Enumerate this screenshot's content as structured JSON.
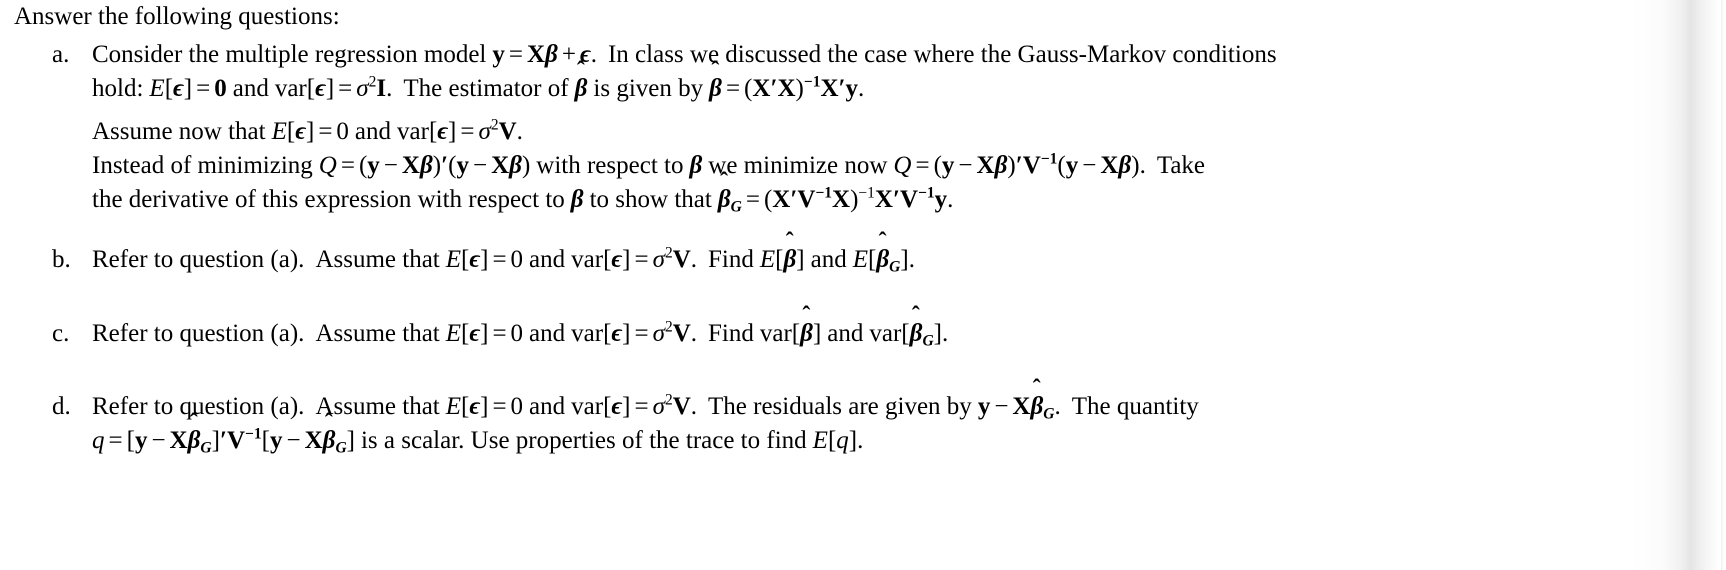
{
  "document": {
    "type": "homework-question-sheet",
    "lead_in": "Answer the following questions:",
    "text_color": "#000000",
    "background_color": "#ffffff"
  },
  "questions": [
    {
      "marker": "a.",
      "lines": [
        {
          "id": "a1",
          "plain": "Consider the multiple regression model y = Xβ + ϵ. In class we discussed the case where the Gauss-Markov conditions"
        },
        {
          "id": "a2",
          "plain": "hold: E[ϵ] = 0 and var[ϵ] = σ²I. The estimator of β̂ is given by β̂ = (X′X)⁻¹X′y."
        },
        {
          "id": "a3",
          "plain": "Assume now that E[ϵ] = 0 and var[ϵ] = σ²V."
        },
        {
          "id": "a4",
          "plain": "Instead of minimizing Q = (y − Xβ)′(y − Xβ) with respect to β we minimize now Q = (y − Xβ)′V⁻¹(y − Xβ). Take"
        },
        {
          "id": "a5",
          "plain": "the derivative of this expression with respect to β to show that β̂_G = (X′V⁻¹X)⁻¹X′V⁻¹y."
        }
      ],
      "words": {
        "consider": "Consider the multiple regression model",
        "in_class": "In class we discussed the case where the Gauss-Markov conditions",
        "hold": "hold:",
        "and": "and",
        "the_estimator": "The estimator of",
        "is_given_by": "is given by",
        "assume_now": "Assume now that",
        "instead": "Instead of minimizing",
        "with_respect": "with respect to",
        "we_minimize": "we minimize now",
        "take": "Take",
        "derivative": "the derivative of this expression with respect to",
        "to_show": "to show that"
      }
    },
    {
      "marker": "b.",
      "lines": [
        {
          "id": "b1",
          "plain": "Refer to question (a). Assume that E[ϵ] = 0 and var[ϵ] = σ²V. Find E[β̂] and E[β̂_G]."
        }
      ],
      "words": {
        "refer": "Refer to question (a).",
        "assume_that": "Assume that",
        "and": "and",
        "find": "Find"
      }
    },
    {
      "marker": "c.",
      "lines": [
        {
          "id": "c1",
          "plain": "Refer to question (a). Assume that E[ϵ] = 0 and var[ϵ] = σ²V. Find var[β̂] and var[β̂_G]."
        }
      ],
      "words": {
        "refer": "Refer to question (a).",
        "assume_that": "Assume that",
        "and": "and",
        "find": "Find"
      }
    },
    {
      "marker": "d.",
      "lines": [
        {
          "id": "d1",
          "plain": "Refer to question (a). Assume that E[ϵ] = 0 and var[ϵ] = σ²V. The residuals are given by y − Xβ̂_G. The quantity"
        },
        {
          "id": "d2",
          "plain": "q = [y − Xβ̂_G]′V⁻¹[y − Xβ̂_G] is a scalar. Use properties of the trace to find E[q]."
        }
      ],
      "words": {
        "refer": "Refer to question (a).",
        "assume_that": "Assume that",
        "and": "and",
        "residuals": "The residuals are given by",
        "quantity": "The quantity",
        "is_scalar": "is a scalar. Use properties of the trace to find",
        "period": "."
      }
    }
  ],
  "symbols": {
    "equals": "=",
    "plus": "+",
    "minus": "−",
    "prime": "′",
    "sigma": "σ",
    "epsilon": "ϵ",
    "beta": "β",
    "hat": "ˆ",
    "zero_bold": "0",
    "zero": "0",
    "exp_two": "2",
    "exp_minus_one": "−1",
    "matrix_X": "X",
    "matrix_V": "V",
    "matrix_I": "I",
    "vector_y": "y",
    "subscript_G": "G",
    "Q": "Q",
    "E": "E",
    "var": "var",
    "q": "q",
    "bracket_open": "[",
    "bracket_close": "]",
    "paren_open": "(",
    "paren_close": ")",
    "period": "."
  }
}
